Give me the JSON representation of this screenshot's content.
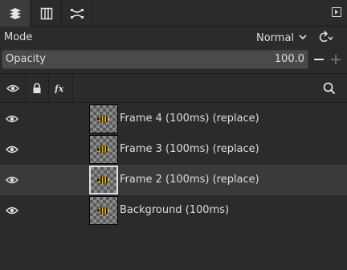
{
  "tabs": [
    {
      "icon": "layers-icon",
      "active": true
    },
    {
      "icon": "channels-icon",
      "active": false
    },
    {
      "icon": "paths-icon",
      "active": false
    }
  ],
  "mode": {
    "label": "Mode",
    "value": "Normal"
  },
  "opacity": {
    "label": "Opacity",
    "value": "100.0"
  },
  "header": {
    "columns": [
      "visibility-icon",
      "lock-icon",
      "effects-fx-icon"
    ],
    "search_icon": "search-icon"
  },
  "layers": [
    {
      "name": "Frame 4 (100ms) (replace)",
      "selected": false
    },
    {
      "name": "Frame 3 (100ms) (replace)",
      "selected": false
    },
    {
      "name": "Frame 2 (100ms) (replace)",
      "selected": true
    },
    {
      "name": "Background (100ms)",
      "selected": false
    }
  ]
}
